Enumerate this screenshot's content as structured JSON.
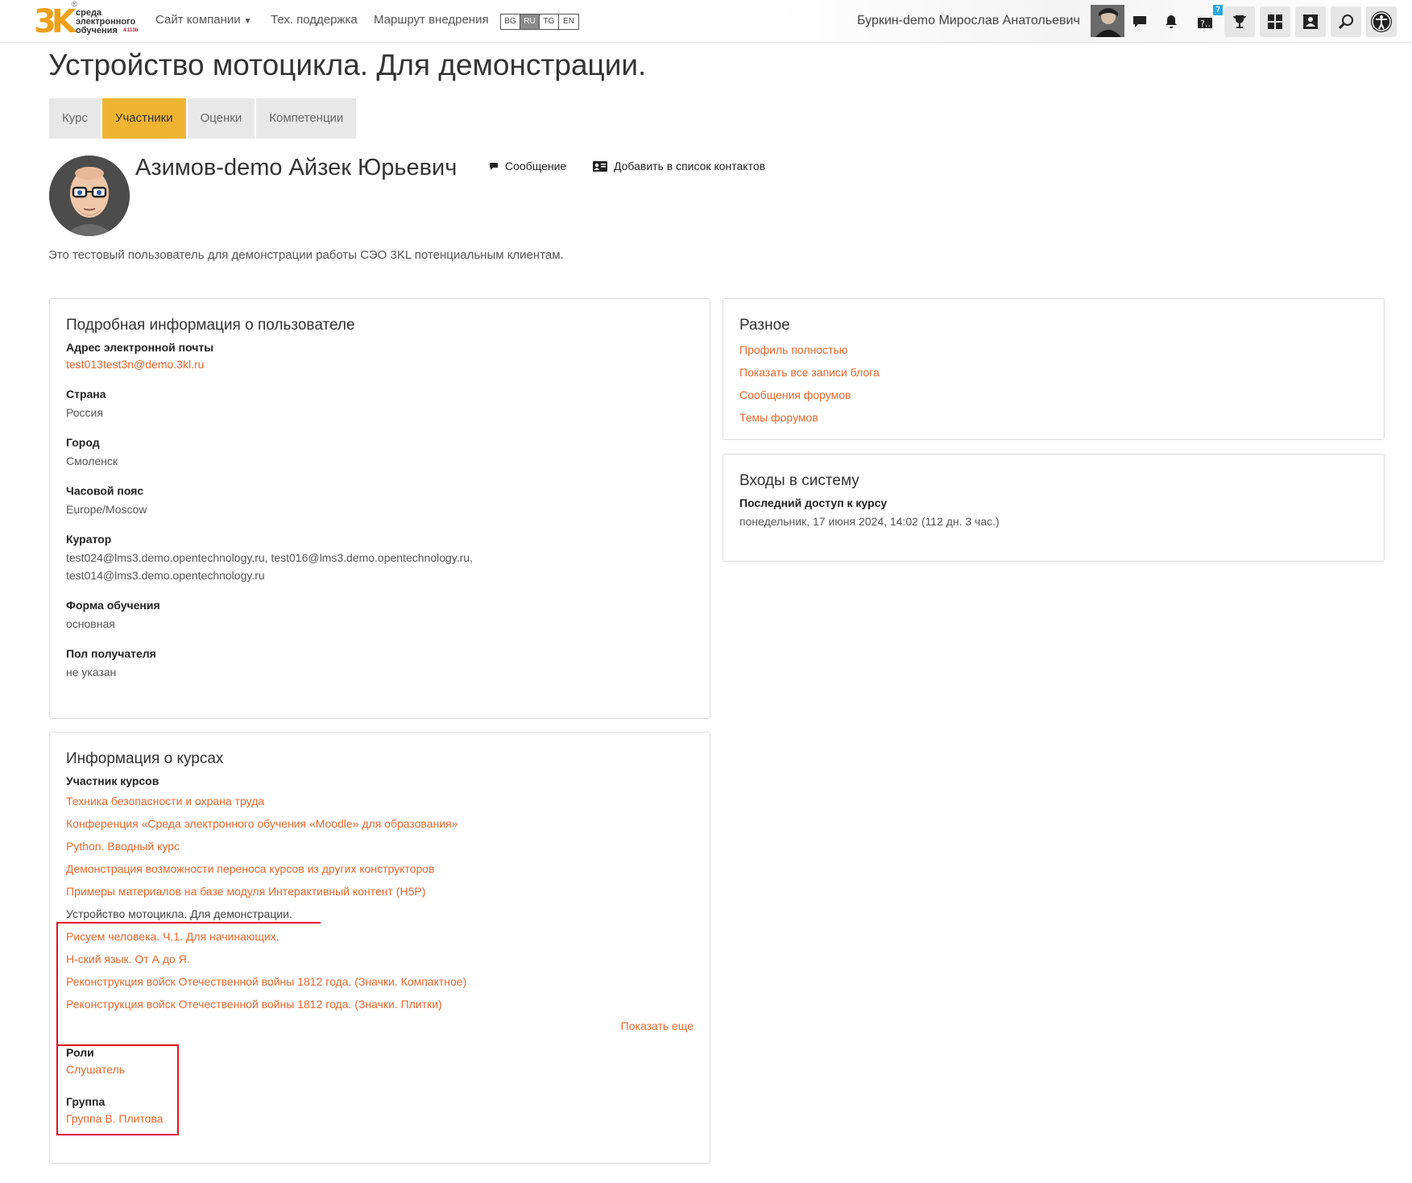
{
  "navbar": {
    "logo": {
      "mark": "3K",
      "registered": "®",
      "line1": "среда",
      "line2": "электронного",
      "line3": "обучения",
      "version": "4.113b"
    },
    "items": [
      {
        "label": "Сайт компании",
        "has_dropdown": true
      },
      {
        "label": "Тех. поддержка"
      },
      {
        "label": "Маршрут внедрения"
      }
    ],
    "languages": [
      {
        "code": "BG",
        "active": false
      },
      {
        "code": "RU",
        "active": true
      },
      {
        "code": "TG",
        "active": false
      },
      {
        "code": "EN",
        "active": false
      }
    ],
    "user_name": "Буркин-demo Мирослав Анатольевич",
    "icons": [
      "avatar",
      "messages-icon",
      "notifications-icon",
      "help-icon",
      "trophy-icon",
      "dashboard-icon",
      "user-card-icon",
      "search-icon",
      "accessibility-icon"
    ],
    "help_badge": "7"
  },
  "page": {
    "title": "Устройство мотоцикла. Для демонстрации.",
    "tabs": [
      {
        "label": "Курс",
        "active": false
      },
      {
        "label": "Участники",
        "active": true
      },
      {
        "label": "Оценки",
        "active": false
      },
      {
        "label": "Компетенции",
        "active": false
      }
    ]
  },
  "profile": {
    "name": "Азимов-demo Айзек Юрьевич",
    "message_label": "Сообщение",
    "add_contact_label": "Добавить в список контактов",
    "description": "Это тестовый пользователь для демонстрации работы СЭО 3KL потенциальным клиентам."
  },
  "user_details": {
    "title": "Подробная информация о пользователе",
    "email_label": "Адрес электронной почты",
    "email": "test013test3n@demo.3kl.ru",
    "country_label": "Страна",
    "country": "Россия",
    "city_label": "Город",
    "city": "Смоленск",
    "timezone_label": "Часовой пояс",
    "timezone": "Europe/Moscow",
    "curator_label": "Куратор",
    "curator_line1": "test024@lms3.demo.opentechnology.ru, test016@lms3.demo.opentechnology.ru,",
    "curator_line2": "test014@lms3.demo.opentechnology.ru",
    "study_form_label": "Форма обучения",
    "study_form": "основная",
    "gender_label": "Пол получателя",
    "gender": "не указан"
  },
  "misc": {
    "title": "Разное",
    "links": [
      "Профиль полностью",
      "Показать все записи блога",
      "Сообщения форумов",
      "Темы форумов"
    ]
  },
  "logins": {
    "title": "Входы в систему",
    "last_access_label": "Последний доступ к курсу",
    "last_access": "понедельник, 17 июня 2024, 14:02  (112 дн. 3 час.)"
  },
  "courses": {
    "title": "Информация о курсах",
    "participant_label": "Участник курсов",
    "list": [
      {
        "label": "Техника безопасности и охрана труда",
        "current": false
      },
      {
        "label": "Конференция «Среда электронного обучения «Moodle» для образования»",
        "current": false
      },
      {
        "label": "Python. Вводный курс",
        "current": false
      },
      {
        "label": "Демонстрация возможности переноса курсов из других конструкторов",
        "current": false
      },
      {
        "label": "Примеры материалов на базе модуля Интерактивный контент (H5P)",
        "current": false
      },
      {
        "label": "Устройство мотоцикла. Для демонстрации.",
        "current": true
      },
      {
        "label": "Рисуем человека. Ч.1. Для начинающих.",
        "current": false
      },
      {
        "label": "Н-ский язык. От А до Я.",
        "current": false
      },
      {
        "label": "Реконструкция войск Отечественной войны 1812 года. (Значки. Компактное)",
        "current": false
      },
      {
        "label": "Реконструкция войск Отечественной войны 1812 года. (Значки. Плитки)",
        "current": false
      }
    ],
    "show_more": "Показать еще",
    "roles_label": "Роли",
    "role": "Слушатель",
    "group_label": "Группа",
    "group": "Группа В. Плитова"
  },
  "colors": {
    "accent_tab": "#f0b433",
    "link": "#e8672c",
    "annotation": "#e0101f"
  }
}
